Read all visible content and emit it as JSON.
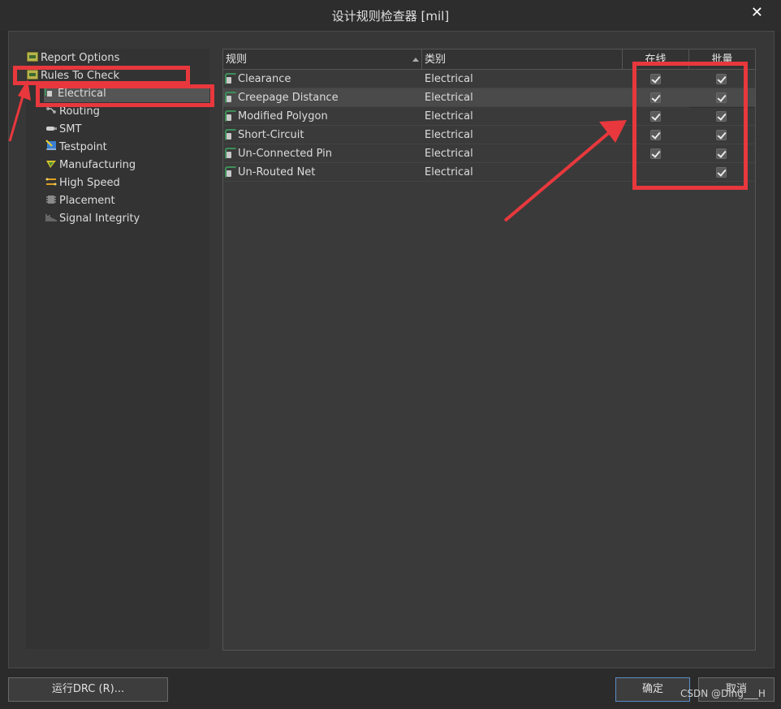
{
  "window": {
    "title": "设计规则检查器 [mil]",
    "close_glyph": "✕"
  },
  "tree": {
    "items": [
      {
        "label": "Report Options",
        "icon": "folder-icon"
      },
      {
        "label": "Rules To Check",
        "icon": "folder-icon"
      },
      {
        "label": "Electrical",
        "icon": "electrical-rule-icon"
      },
      {
        "label": "Routing",
        "icon": "routing-icon"
      },
      {
        "label": "SMT",
        "icon": "smt-icon"
      },
      {
        "label": "Testpoint",
        "icon": "testpoint-icon"
      },
      {
        "label": "Manufacturing",
        "icon": "manufacturing-icon"
      },
      {
        "label": "High Speed",
        "icon": "high-speed-icon"
      },
      {
        "label": "Placement",
        "icon": "placement-icon"
      },
      {
        "label": "Signal Integrity",
        "icon": "signal-integrity-icon"
      }
    ]
  },
  "grid": {
    "headers": {
      "rule": "规则",
      "category": "类别",
      "online": "在线",
      "batch": "批量"
    },
    "rows": [
      {
        "rule": "Clearance",
        "category": "Electrical",
        "online": true,
        "batch": true
      },
      {
        "rule": "Creepage Distance",
        "category": "Electrical",
        "online": true,
        "batch": true
      },
      {
        "rule": "Modified Polygon",
        "category": "Electrical",
        "online": true,
        "batch": true
      },
      {
        "rule": "Short-Circuit",
        "category": "Electrical",
        "online": true,
        "batch": true
      },
      {
        "rule": "Un-Connected Pin",
        "category": "Electrical",
        "online": true,
        "batch": true
      },
      {
        "rule": "Un-Routed Net",
        "category": "Electrical",
        "online": false,
        "batch": true
      }
    ]
  },
  "buttons": {
    "run_drc": "运行DRC (R)...",
    "ok": "确定",
    "cancel": "取消"
  },
  "watermark": "CSDN @Ding___H",
  "colors": {
    "annotation_red": "#e8383d",
    "accent_blue": "#5a8fc9"
  }
}
